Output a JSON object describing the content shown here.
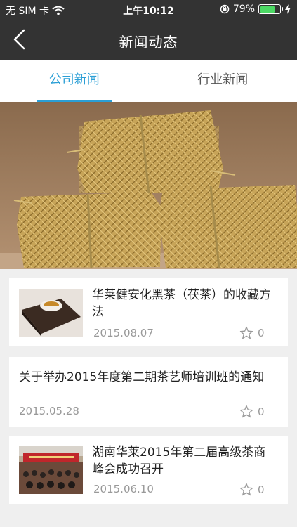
{
  "status_bar": {
    "carrier": "无 SIM 卡",
    "time": "上午10:12",
    "battery": "79%",
    "battery_level": 0.79
  },
  "nav": {
    "title": "新闻动态",
    "back_icon": "chevron-left-icon"
  },
  "tabs": [
    {
      "label": "公司新闻",
      "active": true
    },
    {
      "label": "行业新闻",
      "active": false
    }
  ],
  "news": [
    {
      "title": "华莱健安化黑茶（茯茶）的收藏方法",
      "date": "2015.08.07",
      "count": "0",
      "thumbnail": "tea-brick-thumbnail"
    },
    {
      "title": "关于举办2015年度第二期茶艺师培训班的通知",
      "date": "2015.05.28",
      "count": "0"
    },
    {
      "title": "湖南华莱2015年第二届高级茶商峰会成功召开",
      "date": "2015.06.10",
      "count": "0",
      "thumbnail": "summit-photo-thumbnail"
    }
  ],
  "colors": {
    "accent": "#2a9fd6",
    "navbar": "#333333",
    "background": "#efefef"
  }
}
